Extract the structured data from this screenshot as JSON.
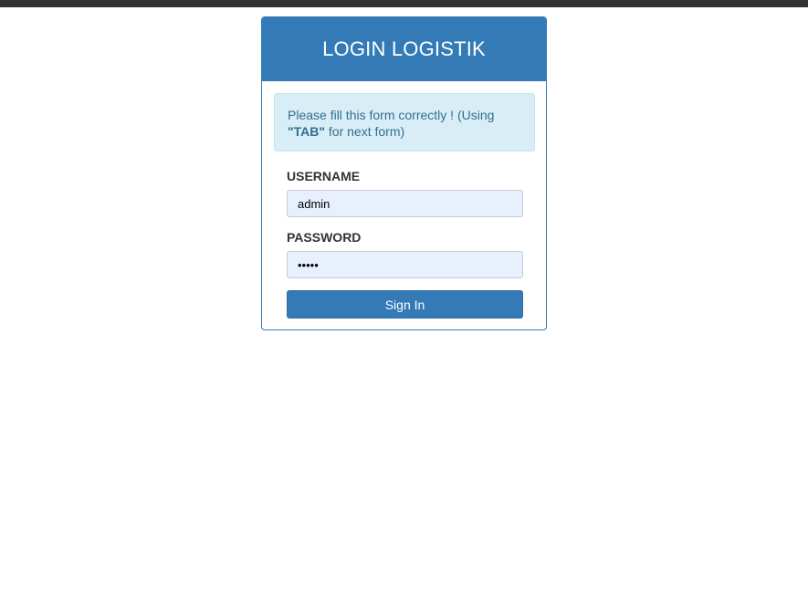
{
  "panel": {
    "title": "LOGIN LOGISTIK"
  },
  "alert": {
    "text_before": "Please fill this form correctly ! (Using ",
    "emphasis": "\"TAB\"",
    "text_after": " for next form)"
  },
  "form": {
    "username_label": "USERNAME",
    "username_value": "admin",
    "password_label": "PASSWORD",
    "password_value": "admin",
    "submit_label": "Sign In"
  },
  "colors": {
    "primary": "#337ab7",
    "alert_bg": "#d9edf7",
    "alert_text": "#31708f",
    "input_bg": "#e8f0fe",
    "topbar": "#333333"
  }
}
